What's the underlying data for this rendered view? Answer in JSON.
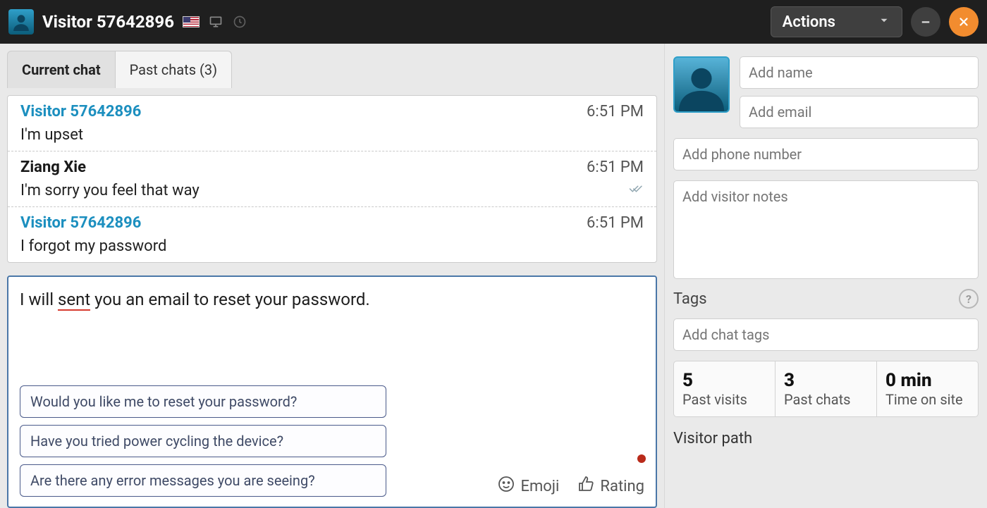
{
  "header": {
    "title": "Visitor 57642896",
    "actions_label": "Actions"
  },
  "tabs": {
    "current": "Current chat",
    "past": "Past chats (3)"
  },
  "messages": [
    {
      "sender": "Visitor 57642896",
      "role": "visitor",
      "time": "6:51 PM",
      "body": "I'm upset"
    },
    {
      "sender": "Ziang Xie",
      "role": "agent",
      "time": "6:51 PM",
      "body": "I'm sorry you feel that way",
      "read": true
    },
    {
      "sender": "Visitor 57642896",
      "role": "visitor",
      "time": "6:51 PM",
      "body": "I forgot my password"
    }
  ],
  "compose": {
    "pre": "I will ",
    "error_word": "sent",
    "post": " you an email to reset your password.",
    "suggestions": [
      "Would you like me to reset your password?",
      "Have you tried power cycling the device?",
      "Are there any error messages you are seeing?"
    ],
    "emoji_label": "Emoji",
    "rating_label": "Rating"
  },
  "sidebar": {
    "name_placeholder": "Add name",
    "email_placeholder": "Add email",
    "phone_placeholder": "Add phone number",
    "notes_placeholder": "Add visitor notes",
    "tags_label": "Tags",
    "tags_placeholder": "Add chat tags",
    "stats": {
      "past_visits": {
        "value": "5",
        "label": "Past visits"
      },
      "past_chats": {
        "value": "3",
        "label": "Past chats"
      },
      "time_on_site": {
        "value": "0 min",
        "label": "Time on site"
      }
    },
    "visitor_path_label": "Visitor path"
  }
}
